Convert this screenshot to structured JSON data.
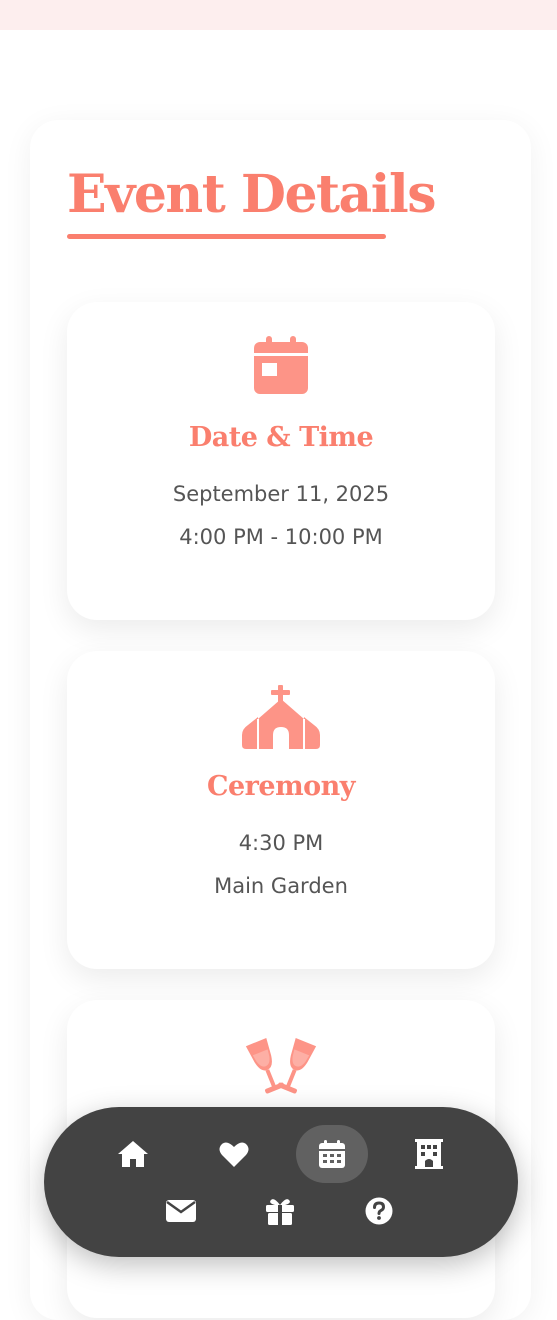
{
  "section": {
    "title": "Event Details"
  },
  "cards": [
    {
      "icon": "calendar-icon",
      "heading": "Date & Time",
      "line1": "September 11, 2025",
      "line2": "4:00 PM - 10:00 PM"
    },
    {
      "icon": "church-icon",
      "heading": "Ceremony",
      "line1": "4:30 PM",
      "line2": "Main Garden"
    },
    {
      "icon": "champagne-glasses-icon",
      "heading": "",
      "line1": "",
      "line2": ""
    }
  ],
  "nav": {
    "items": [
      {
        "icon": "home-icon",
        "active": false
      },
      {
        "icon": "heart-icon",
        "active": false
      },
      {
        "icon": "calendar-icon",
        "active": true
      },
      {
        "icon": "hotel-icon",
        "active": false
      },
      {
        "icon": "envelope-icon",
        "active": false
      },
      {
        "icon": "gift-icon",
        "active": false
      },
      {
        "icon": "question-icon",
        "active": false
      }
    ]
  },
  "colors": {
    "accent": "#fa7f6e",
    "icon_accent": "#fd9487",
    "nav_background": "#434343",
    "nav_active": "#616161",
    "body_text": "#555555"
  }
}
